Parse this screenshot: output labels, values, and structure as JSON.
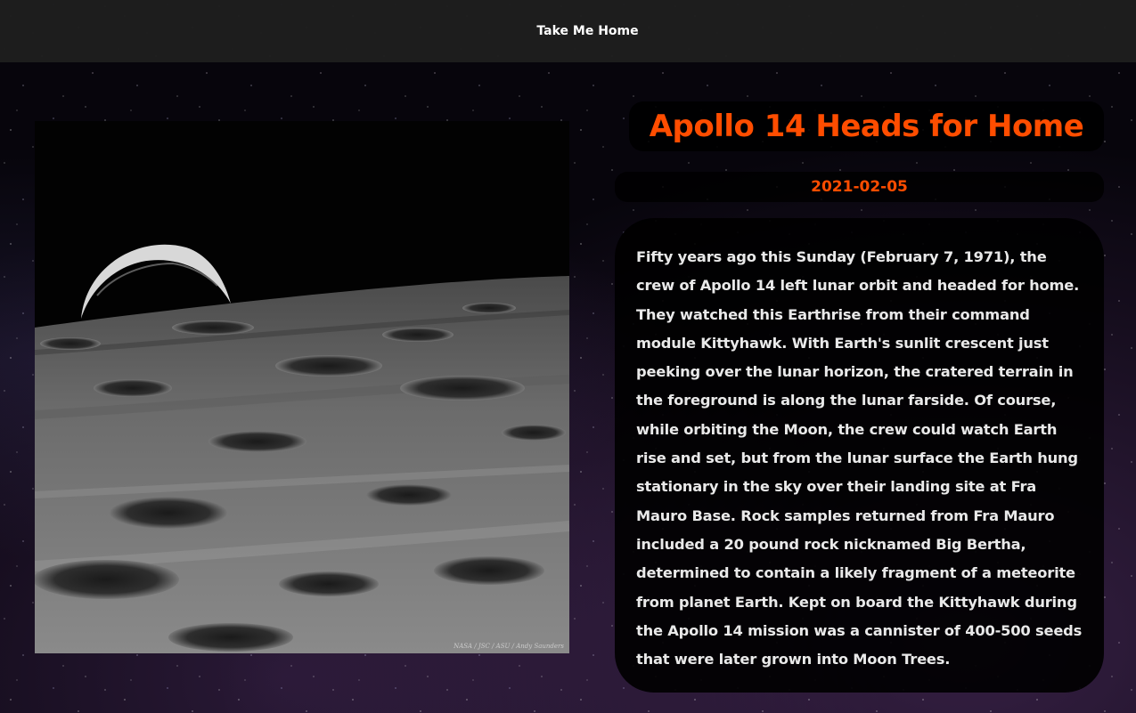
{
  "nav": {
    "home_label": "Take Me Home"
  },
  "apod": {
    "title": "Apollo 14 Heads for Home",
    "date": "2021-02-05",
    "explanation": "Fifty years ago this Sunday (February 7, 1971), the crew of Apollo 14 left lunar orbit and headed for home. They watched this Earthrise from their command module Kittyhawk. With Earth's sunlit crescent just peeking over the lunar horizon, the cratered terrain in the foreground is along the lunar farside. Of course, while orbiting the Moon, the crew could watch Earth rise and set, but from the lunar surface the Earth hung stationary in the sky over their landing site at Fra Mauro Base. Rock samples returned from Fra Mauro included a 20 pound rock nicknamed Big Bertha, determined to contain a likely fragment of a meteorite from planet Earth. Kept on board the Kittyhawk during the Apollo 14 mission was a cannister of 400-500 seeds that were later grown into Moon Trees.",
    "image_credit": "NASA / JSC / ASU / Andy Saunders"
  },
  "colors": {
    "accent": "#ff4d00",
    "navbar_bg": "#1e1e1e",
    "card_bg": "#000000",
    "text": "#e9e9e9"
  }
}
